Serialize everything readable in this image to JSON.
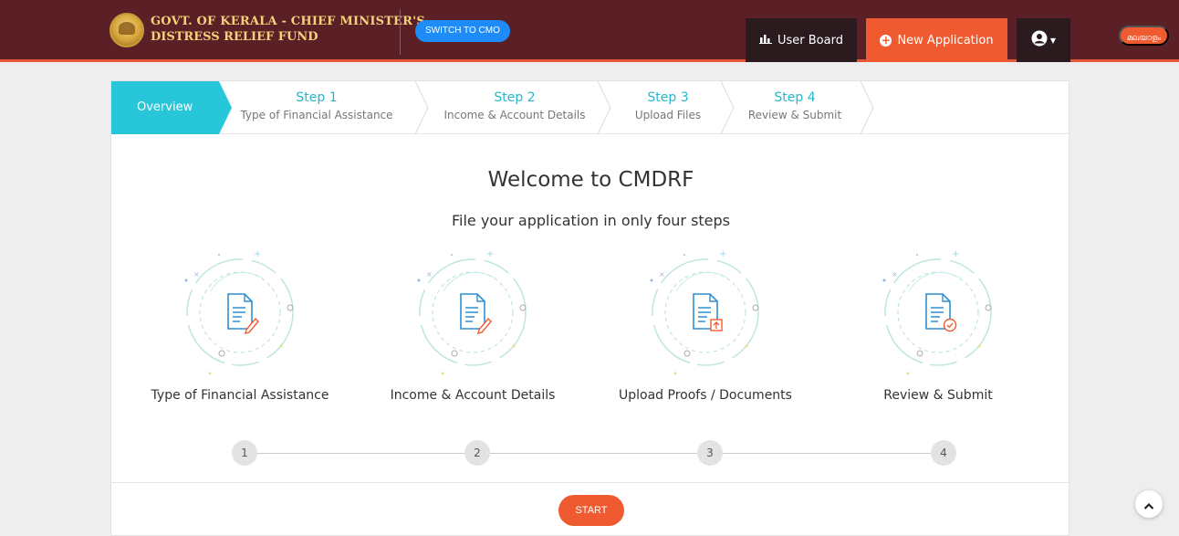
{
  "header": {
    "brand_line1": "GOVT. OF KERALA - CHIEF MINISTER'S",
    "brand_line2": "DISTRESS RELIEF FUND",
    "switch_label": "SWITCH TO CMO",
    "user_board_label": "User Board",
    "new_application_label": "New Application",
    "language_label": "മലയാളം",
    "colors": {
      "bar": "#5a2026",
      "accent": "#f05a30",
      "switch": "#1d8cf8"
    }
  },
  "steps_nav": {
    "overview_label": "Overview",
    "steps": [
      {
        "num": "Step 1",
        "label": "Type of Financial Assistance"
      },
      {
        "num": "Step 2",
        "label": "Income & Account Details"
      },
      {
        "num": "Step 3",
        "label": "Upload Files"
      },
      {
        "num": "Step 4",
        "label": "Review & Submit"
      }
    ],
    "active_color": "#27c6d8"
  },
  "main": {
    "title": "Welcome to CMDRF",
    "subtitle": "File your application in only four steps",
    "illustrations": [
      {
        "label": "Type of Financial Assistance",
        "icon": "document-edit-icon"
      },
      {
        "label": "Income & Account Details",
        "icon": "document-edit-icon"
      },
      {
        "label": "Upload Proofs / Documents",
        "icon": "document-upload-icon"
      },
      {
        "label": "Review & Submit",
        "icon": "document-check-icon"
      }
    ],
    "timeline": [
      "1",
      "2",
      "3",
      "4"
    ],
    "start_label": "START"
  }
}
